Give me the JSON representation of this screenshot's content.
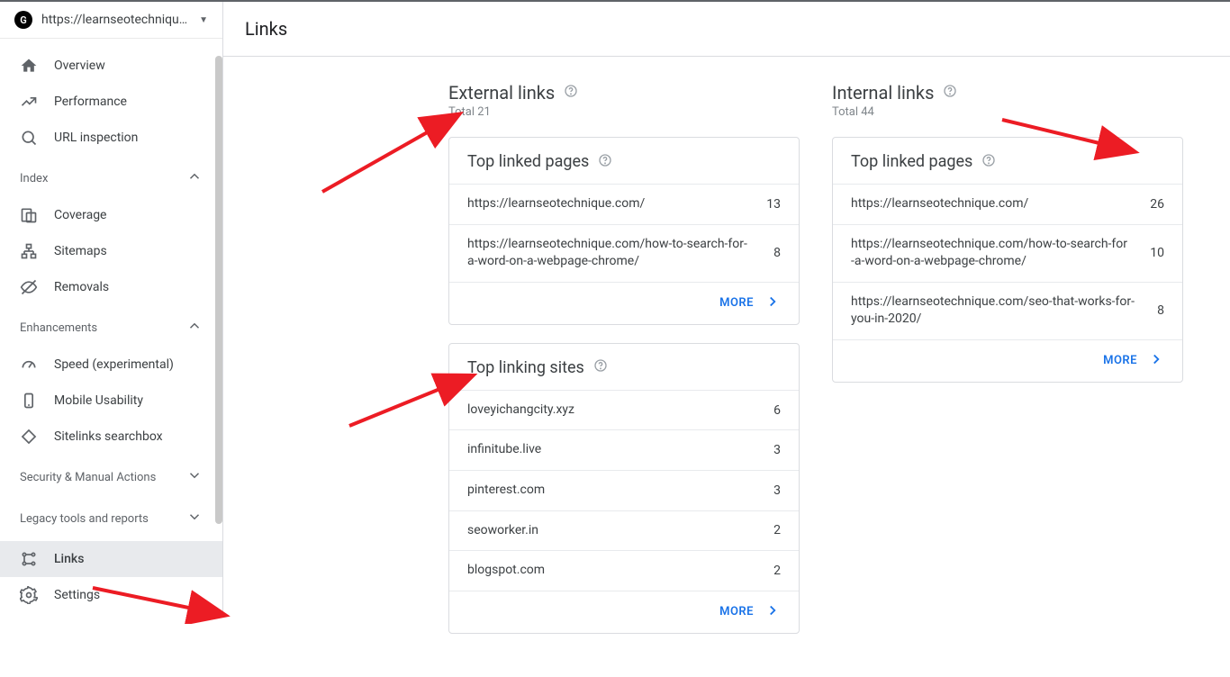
{
  "property": {
    "url": "https://learnseotechnique.co..."
  },
  "page_title": "Links",
  "nav": {
    "overview": "Overview",
    "performance": "Performance",
    "url_inspection": "URL inspection",
    "index_section": "Index",
    "coverage": "Coverage",
    "sitemaps": "Sitemaps",
    "removals": "Removals",
    "enhancements_section": "Enhancements",
    "speed": "Speed (experimental)",
    "mobile": "Mobile Usability",
    "sitelinks": "Sitelinks searchbox",
    "security_section": "Security & Manual Actions",
    "legacy_section": "Legacy tools and reports",
    "links": "Links",
    "settings": "Settings"
  },
  "external": {
    "title": "External links",
    "total": "Total 21",
    "top_pages": {
      "title": "Top linked pages",
      "rows": [
        {
          "url": "https://learnseotechnique.com/",
          "count": "13"
        },
        {
          "url": "https://learnseotechnique.com/how-to-search-for-a-word-on-a-webpage-chrome/",
          "count": "8"
        }
      ],
      "more": "MORE"
    },
    "top_sites": {
      "title": "Top linking sites",
      "rows": [
        {
          "site": "loveyichangcity.xyz",
          "count": "6"
        },
        {
          "site": "infinitube.live",
          "count": "3"
        },
        {
          "site": "pinterest.com",
          "count": "3"
        },
        {
          "site": "seoworker.in",
          "count": "2"
        },
        {
          "site": "blogspot.com",
          "count": "2"
        }
      ],
      "more": "MORE"
    }
  },
  "internal": {
    "title": "Internal links",
    "total": "Total 44",
    "top_pages": {
      "title": "Top linked pages",
      "rows": [
        {
          "url": "https://learnseotechnique.com/",
          "count": "26"
        },
        {
          "url": "https://learnseotechnique.com/how-to-search-for-a-word-on-a-webpage-chrome/",
          "count": "10"
        },
        {
          "url": "https://learnseotechnique.com/seo-that-works-for-you-in-2020/",
          "count": "8"
        }
      ],
      "more": "MORE"
    }
  }
}
